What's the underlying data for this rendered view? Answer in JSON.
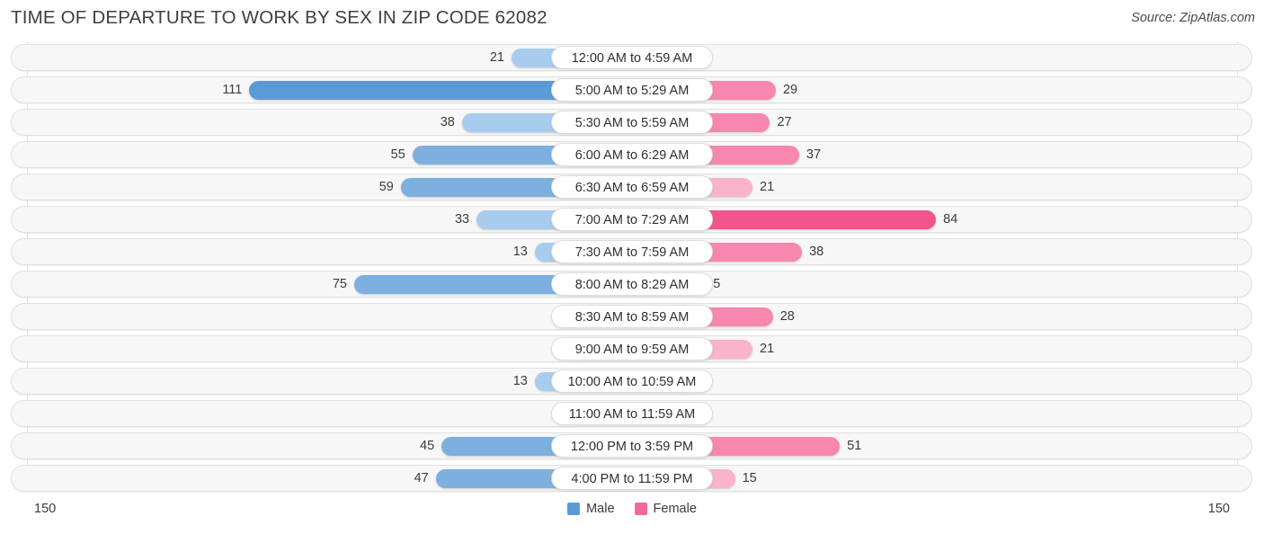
{
  "header": {
    "title": "TIME OF DEPARTURE TO WORK BY SEX IN ZIP CODE 62082",
    "source": "Source: ZipAtlas.com"
  },
  "legend": {
    "male_label": "Male",
    "female_label": "Female",
    "male_color": "#5b9bd5",
    "female_color": "#f2699c"
  },
  "axis": {
    "left_label": "150",
    "right_label": "150",
    "max": 150
  },
  "colors": {
    "male_light": "#a8cced",
    "male_dark": "#5b9bd5",
    "female_light": "#f9b3cb",
    "female_mid": "#f787ae",
    "female_dark": "#f2558c",
    "track_bg": "#f7f7f7",
    "track_border": "#e0e0e0",
    "gridline": "#e3e3e3",
    "text": "#3b3b3b"
  },
  "chart_data": {
    "type": "bar",
    "subtype": "diverging-bidirectional",
    "title": "TIME OF DEPARTURE TO WORK BY SEX IN ZIP CODE 62082",
    "xlabel": "",
    "ylabel": "",
    "xlim": [
      150,
      150
    ],
    "grid": true,
    "legend_position": "bottom-center",
    "categories": [
      "12:00 AM to 4:59 AM",
      "5:00 AM to 5:29 AM",
      "5:30 AM to 5:59 AM",
      "6:00 AM to 6:29 AM",
      "6:30 AM to 6:59 AM",
      "7:00 AM to 7:29 AM",
      "7:30 AM to 7:59 AM",
      "8:00 AM to 8:29 AM",
      "8:30 AM to 8:59 AM",
      "9:00 AM to 9:59 AM",
      "10:00 AM to 10:59 AM",
      "11:00 AM to 11:59 AM",
      "12:00 PM to 3:59 PM",
      "4:00 PM to 11:59 PM"
    ],
    "series": [
      {
        "name": "Male",
        "color": "#5b9bd5",
        "values": [
          21,
          111,
          38,
          55,
          59,
          33,
          13,
          75,
          0,
          0,
          13,
          0,
          45,
          47
        ]
      },
      {
        "name": "Female",
        "color": "#f2699c",
        "values": [
          0,
          29,
          27,
          37,
          21,
          84,
          38,
          5,
          28,
          21,
          0,
          0,
          51,
          15
        ]
      }
    ]
  },
  "rows": [
    {
      "category": "12:00 AM to 4:59 AM",
      "male": "21",
      "female": "0"
    },
    {
      "category": "5:00 AM to 5:29 AM",
      "male": "111",
      "female": "29"
    },
    {
      "category": "5:30 AM to 5:59 AM",
      "male": "38",
      "female": "27"
    },
    {
      "category": "6:00 AM to 6:29 AM",
      "male": "55",
      "female": "37"
    },
    {
      "category": "6:30 AM to 6:59 AM",
      "male": "59",
      "female": "21"
    },
    {
      "category": "7:00 AM to 7:29 AM",
      "male": "33",
      "female": "84"
    },
    {
      "category": "7:30 AM to 7:59 AM",
      "male": "13",
      "female": "38"
    },
    {
      "category": "8:00 AM to 8:29 AM",
      "male": "75",
      "female": "5"
    },
    {
      "category": "8:30 AM to 8:59 AM",
      "male": "0",
      "female": "28"
    },
    {
      "category": "9:00 AM to 9:59 AM",
      "male": "0",
      "female": "21"
    },
    {
      "category": "10:00 AM to 10:59 AM",
      "male": "13",
      "female": "0"
    },
    {
      "category": "11:00 AM to 11:59 AM",
      "male": "0",
      "female": "0"
    },
    {
      "category": "12:00 PM to 3:59 PM",
      "male": "45",
      "female": "51"
    },
    {
      "category": "4:00 PM to 11:59 PM",
      "male": "47",
      "female": "15"
    }
  ]
}
